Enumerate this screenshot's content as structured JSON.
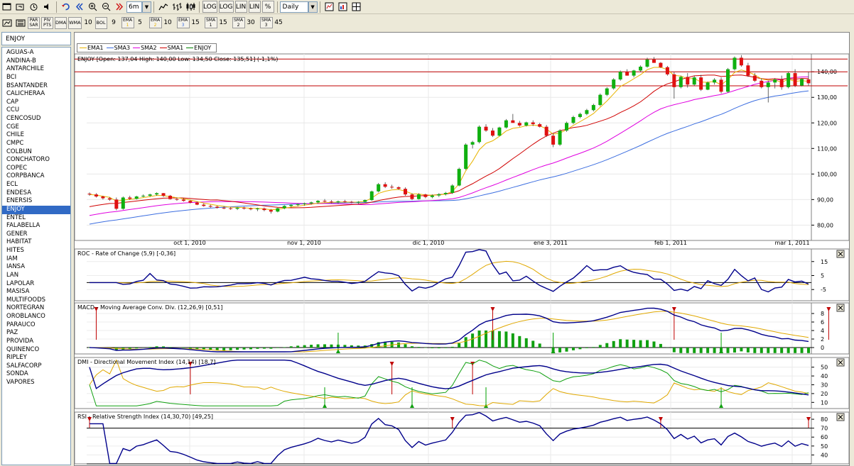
{
  "toolbar": {
    "period": "6m",
    "interval": "Daily",
    "log_label": "LOG",
    "lin_label": "LIN",
    "pct_label": "%"
  },
  "indicators": {
    "par_sar": "PAR SAR",
    "piv_pts": "PIV PTS",
    "dma": "DMA",
    "wma_label": "WMA",
    "wma_val": "10",
    "bol_label": "BOL",
    "bol_val": "9",
    "ema1_label": "EMA",
    "ema1_sub": "1",
    "ema1_val": "5",
    "ema2_label": "EMA",
    "ema2_sub": "2",
    "ema2_val": "10",
    "ema3_label": "EMA",
    "ema3_sub": "3",
    "ema3_val": "15",
    "sma1_label": "SMA",
    "sma1_sub": "1",
    "sma1_val": "15",
    "sma2_label": "SMA",
    "sma2_sub": "2",
    "sma2_val": "30",
    "sma3_label": "SMA",
    "sma3_sub": "3",
    "sma3_val": "45"
  },
  "symbols": {
    "current": "ENJOY",
    "list": [
      "AGUAS-A",
      "ANDINA-B",
      "ANTARCHILE",
      "BCI",
      "BSANTANDER",
      "CALICHERAA",
      "CAP",
      "CCU",
      "CENCOSUD",
      "CGE",
      "CHILE",
      "CMPC",
      "COLBUN",
      "CONCHATORO",
      "COPEC",
      "CORPBANCA",
      "ECL",
      "ENDESA",
      "ENERSIS",
      "ENJOY",
      "ENTEL",
      "FALABELLA",
      "GENER",
      "HABITAT",
      "HITES",
      "IAM",
      "IANSA",
      "LAN",
      "LAPOLAR",
      "MASISA",
      "MULTIFOODS",
      "NORTEGRAN",
      "OROBLANCO",
      "PARAUCO",
      "PAZ",
      "PROVIDA",
      "QUINENCO",
      "RIPLEY",
      "SALFACORP",
      "SONDA",
      "VAPORES"
    ],
    "selected_index": 19
  },
  "legend": [
    {
      "name": "EMA1",
      "color": "#e8b400"
    },
    {
      "name": "SMA3",
      "color": "#3c6ee0"
    },
    {
      "name": "SMA2",
      "color": "#e000e0"
    },
    {
      "name": "SMA1",
      "color": "#d00000"
    },
    {
      "name": "ENJOY",
      "color": "#008000"
    }
  ],
  "chart_data": [
    {
      "type": "candlestick",
      "title": "ENJOY [Open: 137,04  High: 140,00  Low: 134,50  Close: 135,51] (-1,1%)",
      "x_ticks": [
        "oct 1, 2010",
        "nov 1, 2010",
        "dic 1, 2010",
        "ene 3, 2011",
        "feb 1, 2011",
        "mar 1, 2011"
      ],
      "y_ticks": [
        "80,00",
        "90,00",
        "100,00",
        "110,00",
        "120,00",
        "130,00",
        "140,00"
      ],
      "ylim": [
        74,
        147
      ],
      "hlines": [
        145,
        140,
        134.5
      ],
      "ohlc": [
        [
          92.3,
          92.8,
          91.5,
          92.0
        ],
        [
          92.0,
          92.5,
          90.8,
          91.2
        ],
        [
          91.2,
          91.5,
          90.0,
          90.5
        ],
        [
          90.5,
          91.0,
          89.5,
          90.0
        ],
        [
          90.0,
          90.8,
          85.8,
          86.4
        ],
        [
          86.4,
          91.2,
          86.0,
          90.8
        ],
        [
          90.8,
          91.5,
          89.8,
          90.3
        ],
        [
          90.3,
          91.5,
          90.0,
          91.2
        ],
        [
          91.2,
          92.0,
          90.9,
          91.5
        ],
        [
          91.5,
          92.3,
          91.0,
          92.0
        ],
        [
          92.0,
          92.8,
          91.5,
          92.5
        ],
        [
          92.5,
          92.6,
          91.0,
          91.5
        ],
        [
          91.5,
          91.8,
          90.0,
          90.2
        ],
        [
          90.2,
          90.8,
          89.5,
          90.0
        ],
        [
          90.0,
          90.5,
          89.2,
          89.5
        ],
        [
          89.5,
          89.8,
          88.5,
          88.8
        ],
        [
          88.8,
          89.2,
          87.8,
          88.0
        ],
        [
          88.0,
          88.5,
          87.2,
          87.5
        ],
        [
          87.5,
          88.0,
          86.8,
          87.2
        ],
        [
          87.2,
          87.6,
          86.5,
          86.8
        ],
        [
          86.8,
          87.4,
          86.2,
          86.6
        ],
        [
          86.6,
          87.0,
          86.0,
          86.4
        ],
        [
          86.4,
          87.0,
          85.9,
          86.8
        ],
        [
          86.8,
          87.2,
          86.1,
          86.5
        ],
        [
          86.5,
          86.9,
          85.8,
          86.2
        ],
        [
          86.2,
          86.8,
          85.5,
          86.5
        ],
        [
          86.5,
          86.9,
          85.4,
          85.9
        ],
        [
          85.9,
          86.3,
          84.5,
          85.3
        ],
        [
          85.3,
          86.8,
          85.0,
          86.6
        ],
        [
          86.6,
          87.8,
          86.2,
          87.5
        ],
        [
          87.5,
          88.2,
          87.0,
          87.9
        ],
        [
          87.9,
          88.5,
          87.3,
          88.2
        ],
        [
          88.2,
          88.8,
          87.6,
          88.5
        ],
        [
          88.5,
          89.2,
          88.0,
          88.9
        ],
        [
          88.9,
          89.8,
          88.4,
          89.5
        ],
        [
          89.5,
          90.2,
          88.9,
          89.2
        ],
        [
          89.2,
          89.8,
          88.5,
          89.0
        ],
        [
          89.0,
          89.6,
          88.4,
          89.3
        ],
        [
          89.3,
          89.9,
          88.7,
          89.1
        ],
        [
          89.1,
          89.5,
          88.5,
          88.9
        ],
        [
          88.9,
          89.4,
          88.2,
          89.1
        ],
        [
          89.1,
          90.0,
          88.8,
          89.8
        ],
        [
          89.8,
          93.5,
          89.5,
          93.2
        ],
        [
          93.2,
          96.5,
          92.8,
          96.0
        ],
        [
          96.0,
          96.8,
          94.5,
          95.0
        ],
        [
          95.0,
          95.8,
          94.2,
          94.8
        ],
        [
          94.8,
          95.2,
          93.8,
          94.2
        ],
        [
          94.2,
          94.8,
          91.5,
          92.0
        ],
        [
          92.0,
          92.5,
          89.8,
          90.2
        ],
        [
          90.2,
          92.5,
          90.0,
          92.0
        ],
        [
          92.0,
          92.3,
          90.5,
          91.0
        ],
        [
          91.0,
          92.0,
          90.5,
          91.6
        ],
        [
          91.6,
          92.5,
          91.0,
          92.1
        ],
        [
          92.1,
          93.0,
          91.6,
          92.6
        ],
        [
          92.6,
          96.0,
          92.2,
          95.5
        ],
        [
          95.5,
          102.5,
          95.2,
          102.0
        ],
        [
          102.0,
          112.0,
          101.6,
          111.5
        ],
        [
          111.5,
          113.0,
          110.0,
          112.5
        ],
        [
          112.5,
          119.0,
          112.0,
          118.5
        ],
        [
          118.5,
          119.5,
          116.5,
          117.0
        ],
        [
          117.0,
          118.0,
          114.5,
          115.0
        ],
        [
          115.0,
          118.5,
          114.8,
          118.2
        ],
        [
          118.2,
          121.5,
          117.8,
          121.0
        ],
        [
          121.0,
          123.5,
          120.5,
          120.0
        ],
        [
          120.0,
          120.8,
          118.5,
          119.0
        ],
        [
          119.0,
          120.5,
          118.6,
          120.2
        ],
        [
          120.2,
          121.0,
          118.8,
          119.5
        ],
        [
          119.5,
          120.0,
          118.2,
          118.5
        ],
        [
          118.5,
          119.2,
          114.5,
          115.0
        ],
        [
          115.0,
          115.8,
          110.5,
          111.5
        ],
        [
          111.5,
          117.5,
          111.0,
          117.0
        ],
        [
          117.0,
          120.5,
          116.5,
          120.0
        ],
        [
          120.0,
          122.8,
          119.5,
          122.3
        ],
        [
          122.3,
          124.0,
          121.8,
          123.5
        ],
        [
          123.5,
          125.5,
          123.0,
          125.0
        ],
        [
          125.0,
          127.5,
          124.5,
          127.0
        ],
        [
          127.0,
          131.5,
          126.5,
          131.0
        ],
        [
          131.0,
          134.0,
          130.5,
          133.5
        ],
        [
          133.5,
          137.5,
          133.0,
          137.0
        ],
        [
          137.0,
          140.5,
          136.5,
          140.0
        ],
        [
          140.0,
          141.0,
          138.5,
          138.5
        ],
        [
          138.5,
          140.8,
          137.8,
          140.5
        ],
        [
          140.5,
          142.5,
          140.0,
          142.0
        ],
        [
          142.0,
          145.5,
          141.6,
          144.8
        ],
        [
          144.8,
          145.8,
          143.5,
          143.5
        ],
        [
          143.5,
          143.8,
          141.5,
          141.8
        ],
        [
          141.8,
          142.3,
          138.5,
          139.0
        ],
        [
          139.0,
          139.8,
          129.5,
          134.0
        ],
        [
          134.0,
          138.5,
          133.5,
          138.0
        ],
        [
          138.0,
          139.5,
          133.8,
          135.0
        ],
        [
          135.0,
          138.5,
          134.5,
          137.8
        ],
        [
          137.8,
          138.8,
          132.5,
          133.0
        ],
        [
          133.0,
          136.2,
          132.8,
          135.8
        ],
        [
          135.8,
          137.5,
          135.0,
          136.9
        ],
        [
          136.9,
          137.8,
          131.5,
          132.2
        ],
        [
          132.2,
          141.5,
          131.8,
          141.0
        ],
        [
          141.0,
          146.0,
          140.5,
          145.5
        ],
        [
          145.5,
          146.5,
          142.0,
          142.5
        ],
        [
          142.5,
          143.5,
          138.0,
          138.5
        ],
        [
          138.5,
          139.5,
          136.0,
          136.5
        ],
        [
          136.5,
          137.5,
          133.5,
          134.0
        ],
        [
          134.0,
          136.5,
          128.0,
          135.8
        ],
        [
          135.8,
          137.5,
          133.5,
          137.0
        ],
        [
          137.0,
          138.5,
          133.0,
          134.0
        ],
        [
          134.0,
          140.0,
          133.5,
          139.5
        ],
        [
          139.5,
          141.0,
          134.0,
          134.6
        ],
        [
          134.6,
          137.5,
          134.3,
          137.2
        ],
        [
          137.04,
          140.0,
          134.5,
          135.51
        ]
      ]
    },
    {
      "type": "line",
      "title": "ROC - Rate of Change (5,9) [-0,36]",
      "y_ticks": [
        "15",
        "5",
        "-5"
      ],
      "ylim": [
        -13,
        24
      ]
    },
    {
      "type": "line",
      "title": "MACD - Moving Average Conv. Div. (12,26,9) [0,51]",
      "y_ticks": [
        "8",
        "6",
        "4",
        "2",
        "0"
      ],
      "ylim": [
        -1.5,
        10.5
      ]
    },
    {
      "type": "line",
      "title": "DMI - Directional Movement Index (14,14) [18,7]",
      "y_ticks": [
        "50",
        "40",
        "30",
        "20",
        "10"
      ],
      "ylim": [
        3,
        61
      ]
    },
    {
      "type": "line",
      "title": "RSI - Relative Strength Index (14,30,70) [49,25]",
      "y_ticks": [
        "80",
        "70",
        "60",
        "50",
        "40"
      ],
      "ylim": [
        30,
        88
      ],
      "hlines": [
        70,
        30
      ]
    }
  ]
}
